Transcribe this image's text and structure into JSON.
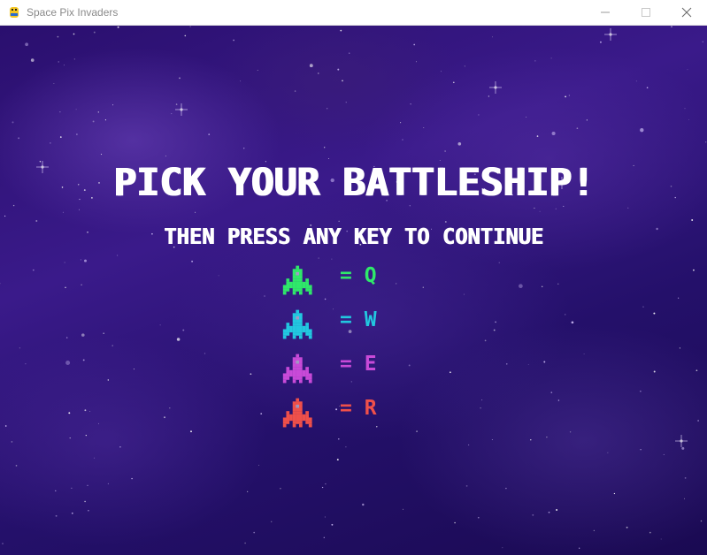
{
  "window": {
    "title": "Space Pix Invaders",
    "minimize_icon": "minimize-icon",
    "maximize_icon": "maximize-icon",
    "close_icon": "close-icon"
  },
  "screen": {
    "headline": "PICK YOUR BATTLESHIP!",
    "subheadline": "THEN PRESS ANY KEY TO CONTINUE"
  },
  "ships": [
    {
      "label": "= Q",
      "key": "Q",
      "color": "#2fe86a",
      "icon": "green-ship-icon"
    },
    {
      "label": "= W",
      "key": "W",
      "color": "#22c8e0",
      "icon": "cyan-ship-icon"
    },
    {
      "label": "= E",
      "key": "E",
      "color": "#c84ad8",
      "icon": "purple-ship-icon"
    },
    {
      "label": "= R",
      "key": "R",
      "color": "#f0504a",
      "icon": "red-ship-icon"
    }
  ]
}
